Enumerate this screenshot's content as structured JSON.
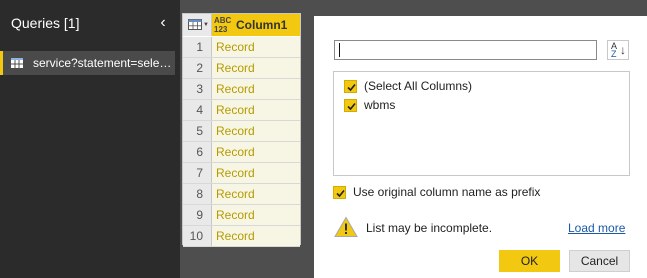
{
  "queries_pane": {
    "title": "Queries [1]",
    "collapse_icon": "chevron-left-icon",
    "items": [
      {
        "label": "service?statement=selec...",
        "icon": "table-icon"
      }
    ]
  },
  "grid": {
    "corner_icon": "table-menu-icon",
    "column": {
      "type_badge_top": "ABC",
      "type_badge_bottom": "123",
      "name": "Column1",
      "expand_icon": "expand-columns-icon"
    },
    "rows": [
      {
        "num": "1",
        "value": "Record"
      },
      {
        "num": "2",
        "value": "Record"
      },
      {
        "num": "3",
        "value": "Record"
      },
      {
        "num": "4",
        "value": "Record"
      },
      {
        "num": "5",
        "value": "Record"
      },
      {
        "num": "6",
        "value": "Record"
      },
      {
        "num": "7",
        "value": "Record"
      },
      {
        "num": "8",
        "value": "Record"
      },
      {
        "num": "9",
        "value": "Record"
      },
      {
        "num": "10",
        "value": "Record"
      }
    ]
  },
  "expand_popup": {
    "search": {
      "value": "",
      "placeholder": ""
    },
    "sort_icon": "sort-az-icon",
    "sort_top": "A",
    "sort_bottom": "Z",
    "options": [
      {
        "label": "(Select All Columns)",
        "checked": true
      },
      {
        "label": "wbms",
        "checked": true
      }
    ],
    "prefix_option": {
      "label": "Use original column name as prefix",
      "checked": true
    },
    "warning": {
      "icon": "warning-icon",
      "text": "List may be incomplete."
    },
    "load_more": "Load more",
    "ok": "OK",
    "cancel": "Cancel"
  },
  "colors": {
    "accent": "#f2c811",
    "pane_bg": "#2b2b2b",
    "record_text": "#b59b00",
    "link": "#1a5aa8"
  }
}
